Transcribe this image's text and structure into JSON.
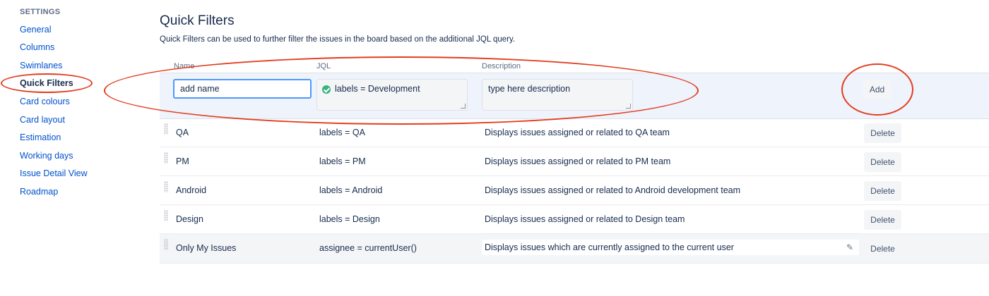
{
  "sidebar": {
    "heading": "SETTINGS",
    "items": [
      {
        "label": "General"
      },
      {
        "label": "Columns"
      },
      {
        "label": "Swimlanes"
      },
      {
        "label": "Quick Filters",
        "active": true
      },
      {
        "label": "Card colours"
      },
      {
        "label": "Card layout"
      },
      {
        "label": "Estimation"
      },
      {
        "label": "Working days"
      },
      {
        "label": "Issue Detail View"
      },
      {
        "label": "Roadmap"
      }
    ]
  },
  "main": {
    "title": "Quick Filters",
    "description": "Quick Filters can be used to further filter the issues in the board based on the additional JQL query.",
    "columns": {
      "name": "Name",
      "jql": "JQL",
      "description": "Description"
    },
    "add_row": {
      "name_value": "add name",
      "jql_value": "labels = Development",
      "description_placeholder": "type here description",
      "add_label": "Add"
    },
    "filters": [
      {
        "name": "QA",
        "jql": "labels = QA",
        "description": "Displays issues assigned or related to QA team",
        "delete_label": "Delete"
      },
      {
        "name": "PM",
        "jql": "labels = PM",
        "description": "Displays issues assigned or related to PM team",
        "delete_label": "Delete"
      },
      {
        "name": "Android",
        "jql": "labels = Android",
        "description": "Displays issues assigned or related to Android development team",
        "delete_label": "Delete"
      },
      {
        "name": "Design",
        "jql": "labels = Design",
        "description": "Displays issues assigned or related to Design team",
        "delete_label": "Delete"
      },
      {
        "name": "Only My Issues",
        "jql": "assignee = currentUser()",
        "description": "Displays issues which are currently assigned to the current user",
        "delete_label": "Delete"
      }
    ]
  },
  "colors": {
    "link": "#0052cc",
    "add_row_bg": "#eef3fc",
    "annotation": "#e23d1e",
    "valid_check": "#36b37e"
  },
  "icons": [
    "check-circle-icon",
    "drag-handle-icon",
    "pencil-icon",
    "resize-grip-icon"
  ]
}
